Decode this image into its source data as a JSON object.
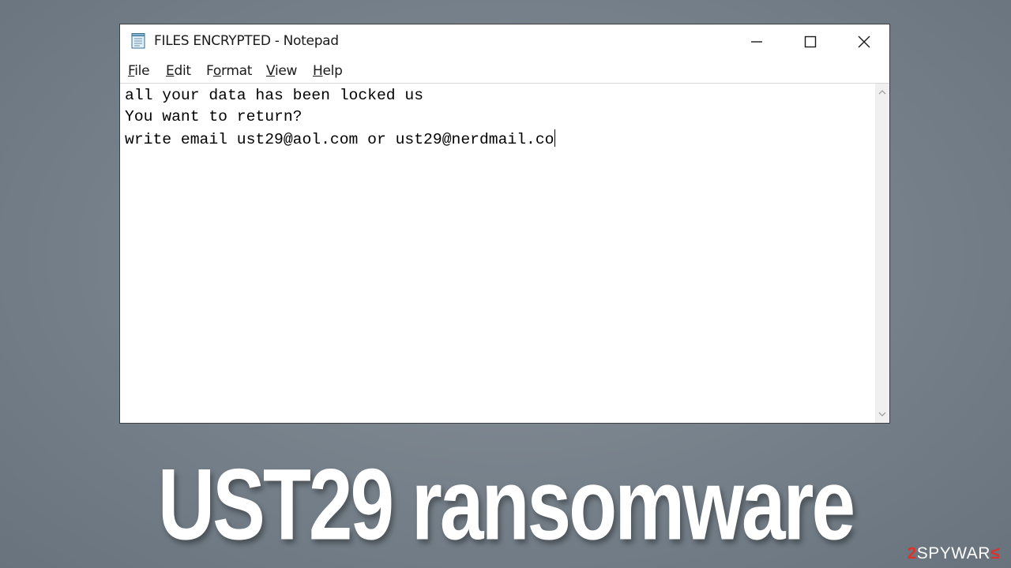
{
  "window": {
    "title": "FILES ENCRYPTED - Notepad",
    "icon": "notepad-icon",
    "controls": {
      "minimize": "minimize-icon",
      "maximize": "maximize-icon",
      "close": "close-icon"
    }
  },
  "menu": {
    "items": [
      {
        "mnemonic": "F",
        "rest": "ile"
      },
      {
        "mnemonic": "E",
        "rest": "dit"
      },
      {
        "mnemonic": "o",
        "pre": "F",
        "rest": "rmat"
      },
      {
        "mnemonic": "V",
        "rest": "iew"
      },
      {
        "mnemonic": "H",
        "rest": "elp"
      }
    ]
  },
  "editor": {
    "lines": [
      "all your data has been locked us",
      "You want to return?",
      "write email ust29@aol.com or ust29@nerdmail.co"
    ]
  },
  "caption": "UST29 ransomware",
  "watermark": {
    "num": "2",
    "text": "SPYWAR",
    "sym": "≤"
  }
}
